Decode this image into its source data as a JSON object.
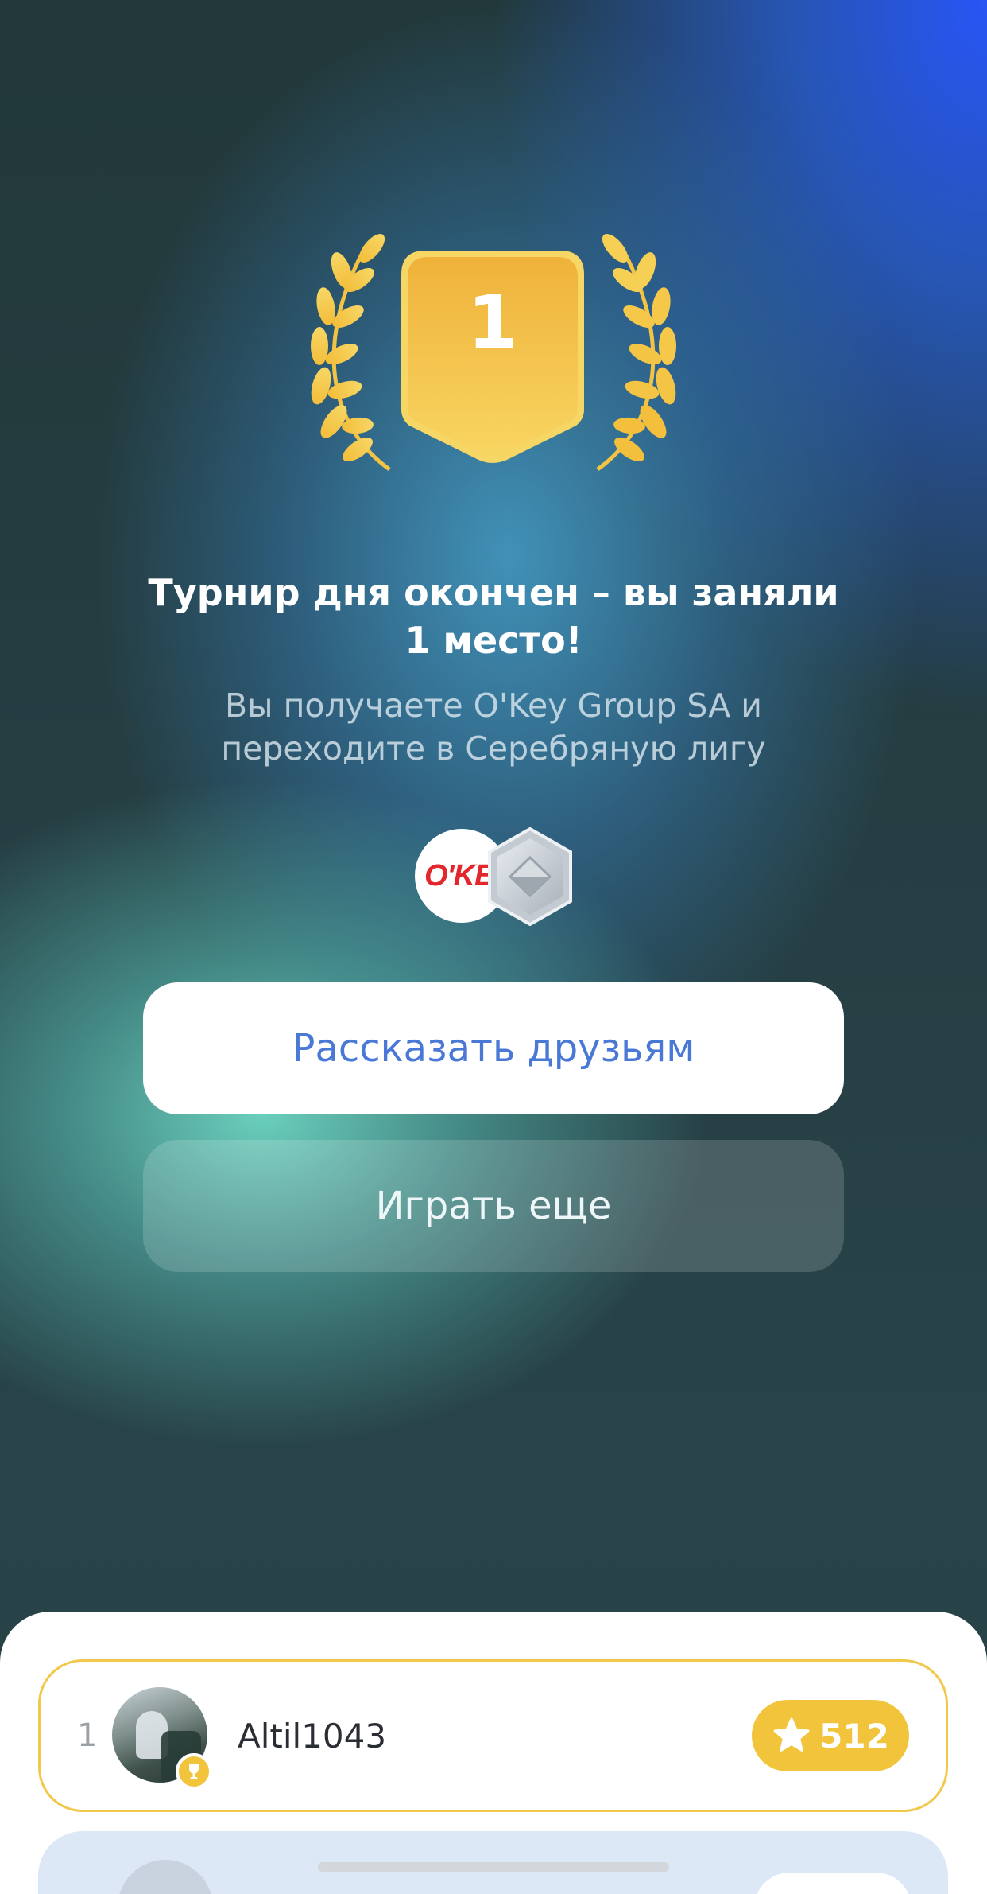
{
  "result": {
    "place_number": "1",
    "title": "Турнир дня окончен – вы заняли 1 место!",
    "subtitle": "Вы получаете O'Key Group SA и переходите в Серебряную лигу",
    "reward_logo_text": "O'KEY",
    "league_icon": "silver-league-icon"
  },
  "actions": {
    "share_label": "Рассказать друзьям",
    "play_again_label": "Играть еще"
  },
  "leaderboard": {
    "rows": [
      {
        "rank": "1",
        "username": "Altil1043",
        "score": "512"
      }
    ]
  },
  "colors": {
    "gold": "#f2c43c",
    "button_text_blue": "#4a78d6",
    "row_highlight_border": "#f1c84b",
    "next_row_bg": "#dde8f7"
  }
}
